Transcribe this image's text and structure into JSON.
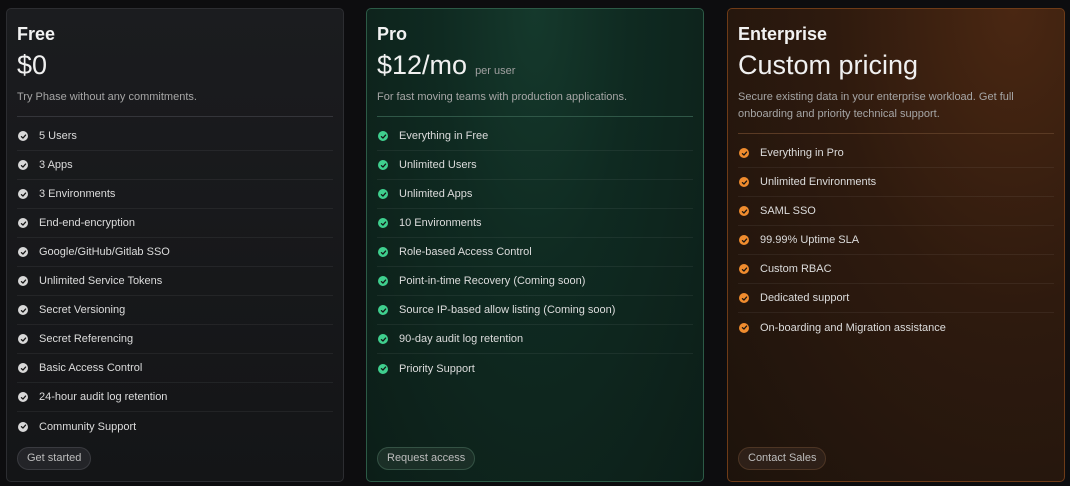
{
  "plans": [
    {
      "name": "Free",
      "price": "$0",
      "price_suffix": "",
      "description": "Try Phase without any commitments.",
      "features": [
        "5 Users",
        "3 Apps",
        "3 Environments",
        "End-end-encryption",
        "Google/GitHub/Gitlab SSO",
        "Unlimited Service Tokens",
        "Secret Versioning",
        "Secret Referencing",
        "Basic Access Control",
        "24-hour audit log retention",
        "Community Support"
      ],
      "cta": "Get started",
      "accent": "#d8d8d8"
    },
    {
      "name": "Pro",
      "price": "$12/mo",
      "price_suffix": "per user",
      "description": "For fast moving teams with production applications.",
      "features": [
        "Everything in Free",
        "Unlimited Users",
        "Unlimited Apps",
        "10 Environments",
        "Role-based Access Control",
        "Point-in-time Recovery (Coming soon)",
        "Source IP-based allow listing (Coming soon)",
        "90-day audit log retention",
        "Priority Support"
      ],
      "cta": "Request access",
      "accent": "#3fcf8e"
    },
    {
      "name": "Enterprise",
      "price": "Custom pricing",
      "price_suffix": "",
      "description": "Secure existing data in your enterprise workload. Get full onboarding and priority technical support.",
      "features": [
        "Everything in Pro",
        "Unlimited Environments",
        "SAML SSO",
        "99.99% Uptime SLA",
        "Custom RBAC",
        "Dedicated support",
        "On-boarding and Migration assistance"
      ],
      "cta": "Contact Sales",
      "accent": "#f08c2e"
    }
  ],
  "icons": {
    "feature_bullet": "check-circle-icon"
  }
}
